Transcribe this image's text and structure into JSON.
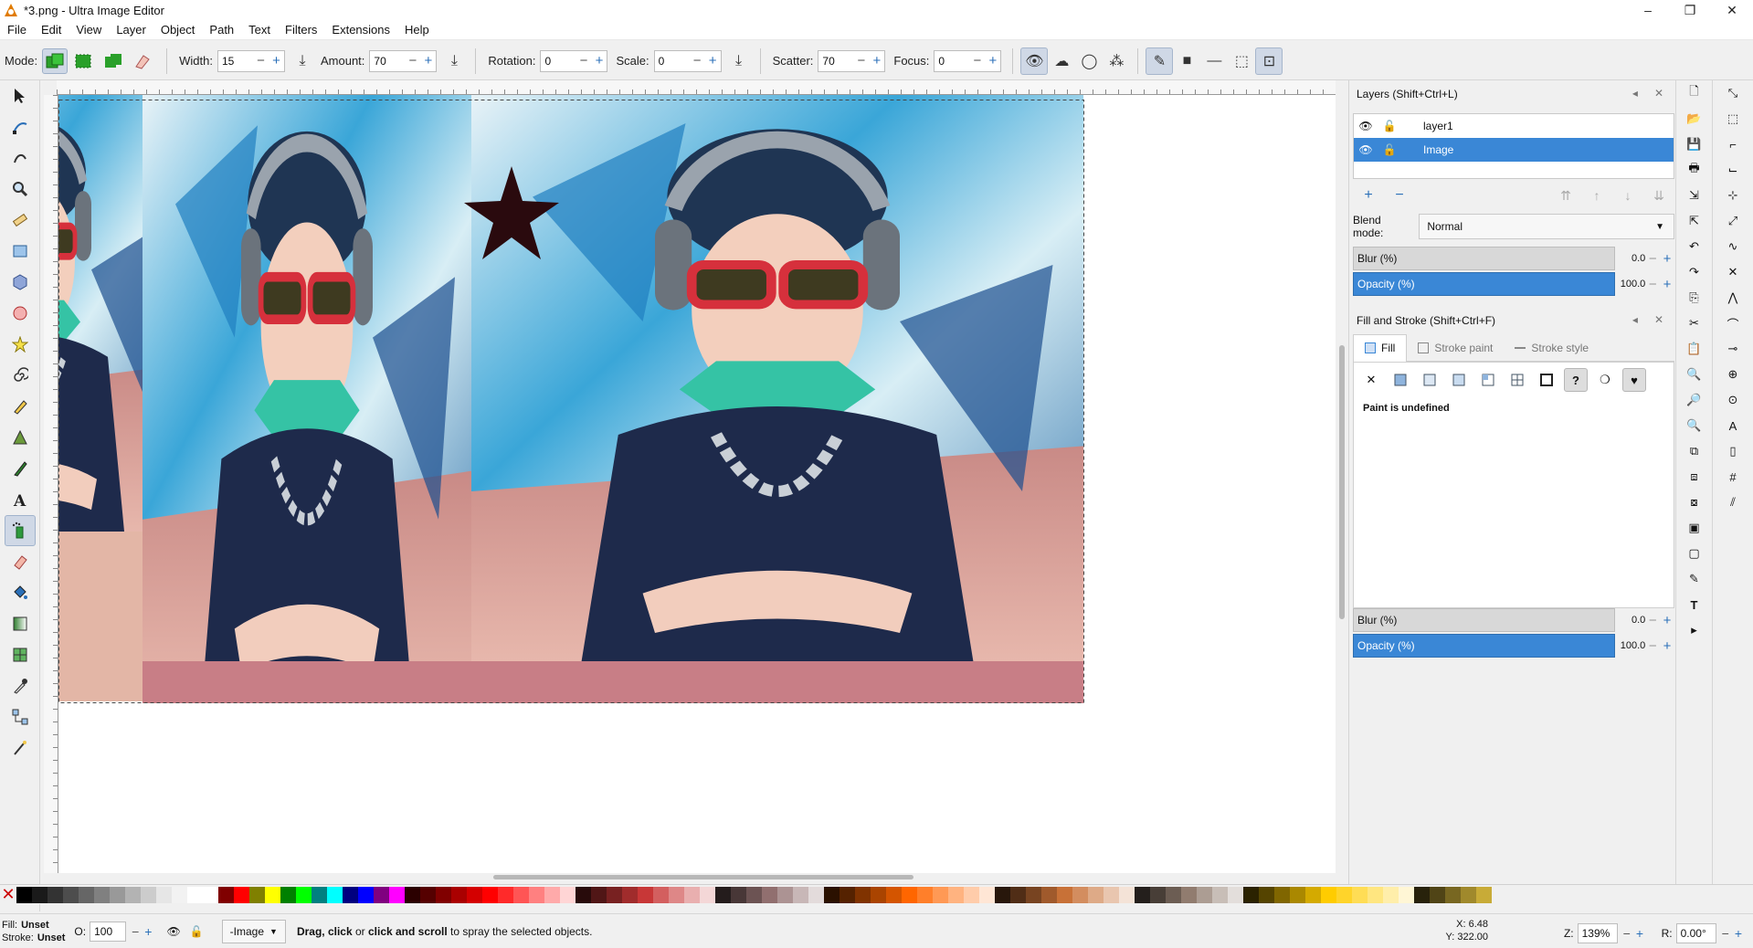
{
  "window": {
    "title": "*3.png - Ultra Image Editor",
    "controls": [
      "–",
      "❐",
      "✕"
    ]
  },
  "menu": [
    "File",
    "Edit",
    "View",
    "Layer",
    "Object",
    "Path",
    "Text",
    "Filters",
    "Extensions",
    "Help"
  ],
  "toolbar": {
    "mode_label": "Mode:",
    "width_label": "Width:",
    "width_value": "15",
    "amount_label": "Amount:",
    "amount_value": "70",
    "rotation_label": "Rotation:",
    "rotation_value": "0",
    "scale_label": "Scale:",
    "scale_value": "0",
    "scatter_label": "Scatter:",
    "scatter_value": "70",
    "focus_label": "Focus:",
    "focus_value": "0"
  },
  "layers_panel": {
    "title": "Layers (Shift+Ctrl+L)",
    "layers": [
      {
        "name": "layer1",
        "selected": false
      },
      {
        "name": "Image",
        "selected": true
      }
    ],
    "blend_label": "Blend mode:",
    "blend_value": "Normal",
    "blur_label": "Blur (%)",
    "blur_value": "0.0",
    "opacity_label": "Opacity (%)",
    "opacity_value": "100.0"
  },
  "fill_stroke_panel": {
    "title": "Fill and Stroke (Shift+Ctrl+F)",
    "tabs": [
      "Fill",
      "Stroke paint",
      "Stroke style"
    ],
    "active_tab": "Fill",
    "paint_status": "Paint is undefined",
    "blur_label": "Blur (%)",
    "blur_value": "0.0",
    "opacity_label": "Opacity (%)",
    "opacity_value": "100.0"
  },
  "status": {
    "fill_label": "Fill:",
    "fill_value": "Unset",
    "stroke_label": "Stroke:",
    "stroke_value": "Unset",
    "opacity_label": "O:",
    "opacity_value": "100",
    "layer_value": "-Image",
    "message_strong1": "Drag, click",
    "message_mid": " or ",
    "message_strong2": "click and scroll",
    "message_tail": " to spray the selected objects.",
    "x_label": "X:",
    "x_value": "6.48",
    "y_label": "Y:",
    "y_value": "322.00",
    "zoom_label": "Z:",
    "zoom_value": "139%",
    "rot_label": "R:",
    "rot_value": "0.00°"
  },
  "colors": {
    "accent": "#3a87d6",
    "star": "#2a0a0e"
  },
  "palette": [
    "#000000",
    "#1a1a1a",
    "#333333",
    "#4d4d4d",
    "#666666",
    "#808080",
    "#999999",
    "#b3b3b3",
    "#cccccc",
    "#e6e6e6",
    "#f2f2f2",
    "#ffffff",
    "#ffffff",
    "#800000",
    "#ff0000",
    "#808000",
    "#ffff00",
    "#008000",
    "#00ff00",
    "#008080",
    "#00ffff",
    "#000080",
    "#0000ff",
    "#800080",
    "#ff00ff",
    "#2b0000",
    "#550000",
    "#800000",
    "#aa0000",
    "#d40000",
    "#ff0000",
    "#ff2a2a",
    "#ff5555",
    "#ff8080",
    "#ffaaaa",
    "#ffd5d5",
    "#280b0b",
    "#501616",
    "#782121",
    "#a02c2c",
    "#c83737",
    "#d35f5f",
    "#de8787",
    "#e9afaf",
    "#f4d7d7",
    "#241c1c",
    "#483737",
    "#6c5353",
    "#916f6f",
    "#ac9393",
    "#c8b7b7",
    "#e3dbdb",
    "#2b1100",
    "#552200",
    "#803300",
    "#aa4400",
    "#d45500",
    "#ff6600",
    "#ff7f2a",
    "#ff9955",
    "#ffb380",
    "#ffccaa",
    "#ffe6d5",
    "#28170b",
    "#502d16",
    "#784421",
    "#a05a2c",
    "#c87137",
    "#d38d5f",
    "#deaa87",
    "#e9c6af",
    "#f4e3d7",
    "#241f1c",
    "#483e37",
    "#6c5d53",
    "#917c6f",
    "#ac9d93",
    "#c8beb7",
    "#e3dedb",
    "#2b2200",
    "#554400",
    "#806600",
    "#aa8800",
    "#d4aa00",
    "#ffcc00",
    "#ffd42a",
    "#ffdd55",
    "#ffe680",
    "#ffeeaa",
    "#fff6d5",
    "#28220b",
    "#504416",
    "#786721",
    "#a0892c",
    "#c8ab37"
  ]
}
